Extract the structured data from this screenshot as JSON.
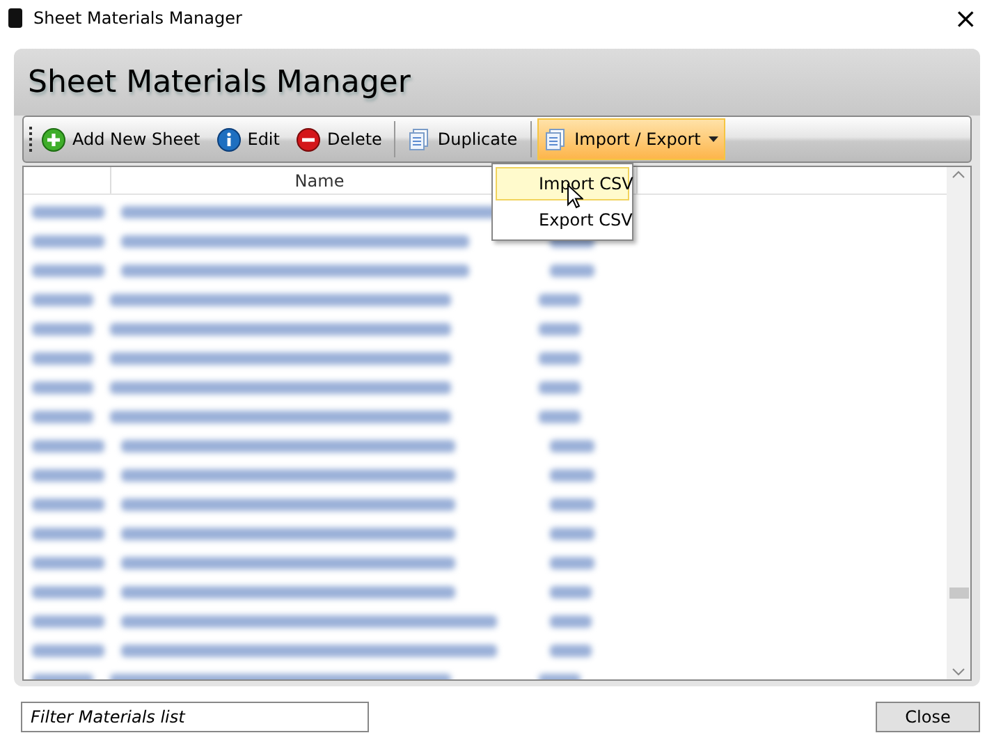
{
  "window": {
    "title": "Sheet Materials Manager",
    "close": "×"
  },
  "heading": "Sheet Materials Manager",
  "toolbar": [
    {
      "kind": "add",
      "label": "Add New Sheet"
    },
    {
      "kind": "info",
      "label": "Edit"
    },
    {
      "kind": "delete",
      "label": "Delete"
    },
    {
      "kind": "separator"
    },
    {
      "kind": "copy",
      "label": "Duplicate"
    },
    {
      "kind": "separator"
    },
    {
      "kind": "dropdown",
      "label": "Import / Export",
      "expanded": true
    }
  ],
  "menu": [
    {
      "label": "Import CSV",
      "selected": true
    },
    {
      "label": "Export CSV",
      "selected": false
    }
  ],
  "table": {
    "columns": [
      "",
      "Name",
      ""
    ],
    "rows": [
      {
        "kind": "blurred"
      },
      {
        "kind": "blurred"
      },
      {
        "kind": "blurred"
      },
      {
        "kind": "blurred"
      },
      {
        "kind": "blurred"
      },
      {
        "kind": "blurred"
      },
      {
        "kind": "blurred"
      },
      {
        "kind": "blurred"
      },
      {
        "kind": "blurred"
      },
      {
        "kind": "blurred"
      },
      {
        "kind": "blurred"
      },
      {
        "kind": "blurred"
      },
      {
        "kind": "blurred"
      },
      {
        "kind": "blurred"
      },
      {
        "kind": "blurred"
      },
      {
        "kind": "blurred"
      },
      {
        "kind": "blurred"
      }
    ]
  },
  "filter": {
    "placeholder": "Filter Materials list"
  },
  "buttons": [
    "Close"
  ]
}
